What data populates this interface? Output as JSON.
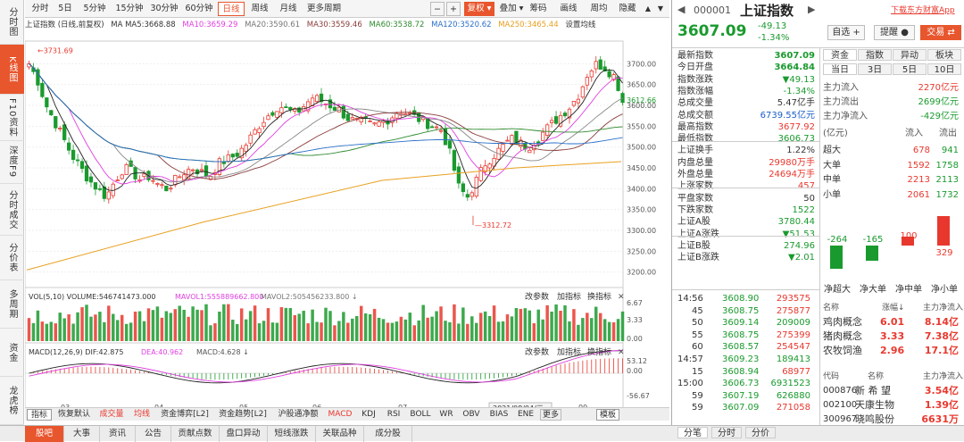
{
  "leftnav": [
    {
      "label": "分时图"
    },
    {
      "label": "K线图",
      "active": true
    },
    {
      "label": "F10资料"
    },
    {
      "label": "深度F9"
    },
    {
      "label": "分时成交"
    },
    {
      "label": "分价表"
    },
    {
      "label": "多周期"
    },
    {
      "label": "资金"
    },
    {
      "label": "龙虎榜"
    }
  ],
  "toolbar": {
    "periods": [
      "分时",
      "5日",
      "5分钟",
      "15分钟",
      "30分钟",
      "60分钟",
      "日线",
      "周线",
      "月线",
      "更多周期"
    ],
    "active_period": "日线",
    "zoom_minus": "−",
    "zoom_plus": "+",
    "right_btns": [
      "复权",
      "叠加",
      "筹码",
      "画线",
      "周均",
      "隐藏"
    ],
    "icon_up": "▲",
    "icon_down": "▼"
  },
  "ma_line": {
    "title": "上证指数 (日线,前复权)",
    "ma5": "MA MA5:3668.88",
    "ma10": "MA10:3659.29",
    "ma20": "MA20:3590.61",
    "ma30": "MA30:3559.46",
    "ma60": "MA60:3538.72",
    "ma120": "MA120:3520.62",
    "ma250": "MA250:3465.44",
    "setting": "设置均线"
  },
  "chart_annot": {
    "high": "3731.69",
    "low": "3312.72",
    "price_axis": [
      "3700.00",
      "3650.00",
      "3612.66",
      "3600.00",
      "3550.00",
      "3500.00",
      "3450.00",
      "3400.00",
      "3350.00",
      "3300.00",
      "3250.00",
      "3200.00"
    ],
    "vol_axis": [
      "6.67",
      "3.33",
      "0.00"
    ],
    "macd_axis": [
      "53.12",
      "0.00",
      "-56.67"
    ],
    "months": [
      "03",
      "04",
      "05",
      "06",
      "07",
      "08",
      "09"
    ],
    "date_tip": "2021/08/04/三"
  },
  "vol_hdr": {
    "vol": "VOL(5,10)",
    "volume": "VOLUME:546741473.000",
    "mavol1": "MAVOL1:555889662.800",
    "mavol2": "MAVOL2:505456233.800",
    "arrow": "↓"
  },
  "macd_hdr": {
    "name": "MACD(12,26,9)",
    "dif": "DIF:42.875",
    "dea": "DEA:40.962",
    "macd": "MACD:4.628",
    "arrow": "↓"
  },
  "panel_btns": {
    "param": "改参数",
    "add": "加指标",
    "switch": "换指标",
    "close": "✕"
  },
  "btabs": [
    "指标",
    "恢复默认",
    "成交量",
    "均线",
    "资金博弈[L2]",
    "资金趋势[L2]",
    "沪股通净额",
    "MACD",
    "KDJ",
    "RSI",
    "BOLL",
    "WR",
    "OBV",
    "BIAS",
    "ENE",
    "更多",
    "模板"
  ],
  "bottombar": [
    "股吧",
    "大事",
    "资讯",
    "公告",
    "贡献点数",
    "盘口异动",
    "短线涨跌",
    "关联品种",
    "成分股"
  ],
  "right": {
    "code": "000001",
    "name": "上证指数",
    "download": "下载东方财富App",
    "price": "3607.09",
    "change": "-49.13",
    "pct": "-1.34%",
    "btn_self": "自选 +",
    "btn_alert": "提醒 ●",
    "btn_trade": "交易 ⇄",
    "quote": [
      [
        "最新指数",
        "3607.09",
        "green"
      ],
      [
        "今日开盘",
        "3664.84",
        "green"
      ],
      [
        "指数涨跌",
        "▼49.13",
        "green"
      ],
      [
        "指数涨幅",
        "-1.34%",
        "green"
      ],
      [
        "总成交量",
        "5.47亿手",
        "#333"
      ],
      [
        "总成交额",
        "6739.55亿元",
        "#1a5fc8"
      ],
      [
        "最高指数",
        "3677.92",
        "red"
      ],
      [
        "最低指数",
        "3606.73",
        "green"
      ],
      [
        "上证换手",
        "1.22%",
        "#333"
      ],
      [
        "内盘总量",
        "29980万手",
        "red"
      ],
      [
        "外盘总量",
        "24694万手",
        "red"
      ],
      [
        "上涨家数",
        "457",
        "red"
      ],
      [
        "平盘家数",
        "50",
        "#333"
      ],
      [
        "下跌家数",
        "1522",
        "green"
      ],
      [
        "上证A股",
        "3780.44",
        "green"
      ],
      [
        "上证A涨跌",
        "▼51.53",
        "green"
      ],
      [
        "上证B股",
        "274.96",
        "green"
      ],
      [
        "上证B涨跌",
        "▼2.01",
        "green"
      ]
    ],
    "ticks": [
      [
        "14:56",
        "3608.90",
        "293575"
      ],
      [
        "45",
        "3608.75",
        "275877"
      ],
      [
        "50",
        "3609.14",
        "209009"
      ],
      [
        "55",
        "3608.75",
        "275399"
      ],
      [
        "60",
        "3608.57",
        "254547"
      ],
      [
        "14:57",
        "3609.23",
        "189413"
      ],
      [
        "15",
        "3608.94",
        "68977"
      ],
      [
        "15:00",
        "3606.73",
        "6931523"
      ],
      [
        "59",
        "3607.19",
        "626880"
      ],
      [
        "59",
        "3607.09",
        "271058"
      ]
    ],
    "tick_tabs": [
      "分笔",
      "分时",
      "分价"
    ],
    "fund_tabs": [
      "资金",
      "指数",
      "异动",
      "板块"
    ],
    "day_tabs": [
      "当日",
      "3日",
      "5日",
      "10日"
    ],
    "flow": [
      [
        "主力流入",
        "2270亿元"
      ],
      [
        "主力流出",
        "2699亿元"
      ],
      [
        "主力净流入",
        "-429亿元"
      ]
    ],
    "flow_tbl_hdr": [
      "(亿元)",
      "流入",
      "流出"
    ],
    "flow_tbl": [
      [
        "超大",
        "678",
        "941"
      ],
      [
        "大单",
        "1592",
        "1758"
      ],
      [
        "中单",
        "2213",
        "2113"
      ],
      [
        "小单",
        "2061",
        "1732"
      ]
    ],
    "net_bars": [
      {
        "label": "净超大",
        "value": -264
      },
      {
        "label": "净大单",
        "value": -165
      },
      {
        "label": "净中单",
        "value": 100
      },
      {
        "label": "净小单",
        "value": 329
      }
    ],
    "net_labels": [
      "-264",
      "-165",
      "100",
      "329"
    ],
    "concept_hdr": [
      "名称",
      "涨幅↓",
      "主力净流入"
    ],
    "concepts": [
      [
        "鸡肉概念",
        "6.01",
        "8.14亿"
      ],
      [
        "猪肉概念",
        "3.33",
        "7.38亿"
      ],
      [
        "农牧饲渔",
        "2.96",
        "17.1亿"
      ]
    ],
    "stock_hdr": [
      "代码",
      "名称",
      "主力净流入"
    ],
    "stocks": [
      [
        "000876",
        "新 希 望",
        "3.54亿"
      ],
      [
        "002100",
        "天康生物",
        "1.39亿"
      ],
      [
        "300967",
        "晓鸣股份",
        "6631万"
      ]
    ]
  },
  "chart_data": {
    "type": "candlestick",
    "title": "上证指数 (日线,前复权)",
    "ylim": [
      3180,
      3750
    ],
    "high": 3731.69,
    "low": 3312.72,
    "last_close": 3607.09,
    "months": [
      "03",
      "04",
      "05",
      "06",
      "07",
      "08",
      "09"
    ]
  }
}
